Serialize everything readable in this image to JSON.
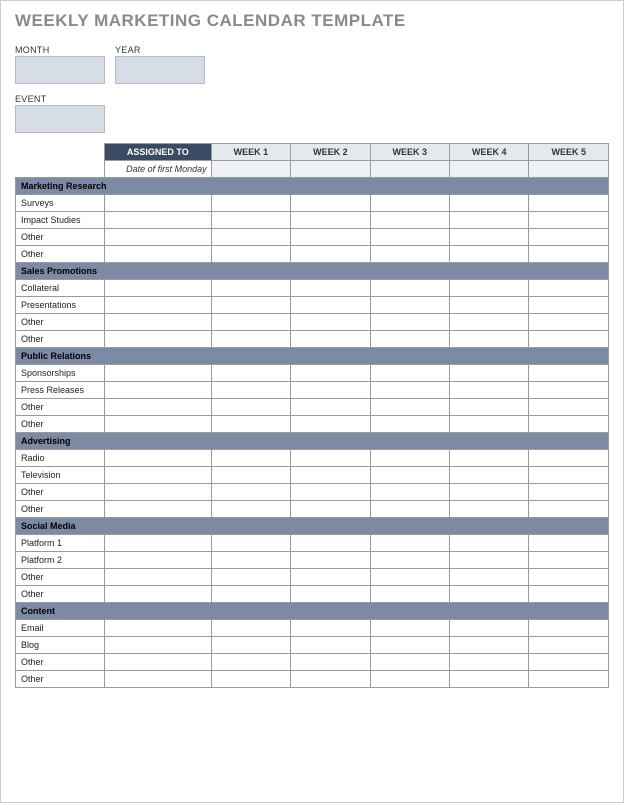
{
  "title": "WEEKLY MARKETING CALENDAR TEMPLATE",
  "fields": {
    "month_label": "MONTH",
    "year_label": "YEAR",
    "event_label": "EVENT"
  },
  "table": {
    "assigned_header": "ASSIGNED TO",
    "week_headers": [
      "WEEK 1",
      "WEEK 2",
      "WEEK 3",
      "WEEK 4",
      "WEEK 5"
    ],
    "date_first_monday": "Date of first Monday",
    "sections": [
      {
        "name": "Marketing Research",
        "rows": [
          "Surveys",
          "Impact Studies",
          "Other",
          "Other"
        ]
      },
      {
        "name": "Sales Promotions",
        "rows": [
          "Collateral",
          "Presentations",
          "Other",
          "Other"
        ]
      },
      {
        "name": "Public Relations",
        "rows": [
          "Sponsorships",
          "Press Releases",
          "Other",
          "Other"
        ]
      },
      {
        "name": "Advertising",
        "rows": [
          "Radio",
          "Television",
          "Other",
          "Other"
        ]
      },
      {
        "name": "Social Media",
        "rows": [
          "Platform 1",
          "Platform 2",
          "Other",
          "Other"
        ]
      },
      {
        "name": "Content",
        "rows": [
          "Email",
          "Blog",
          "Other",
          "Other"
        ]
      }
    ]
  }
}
